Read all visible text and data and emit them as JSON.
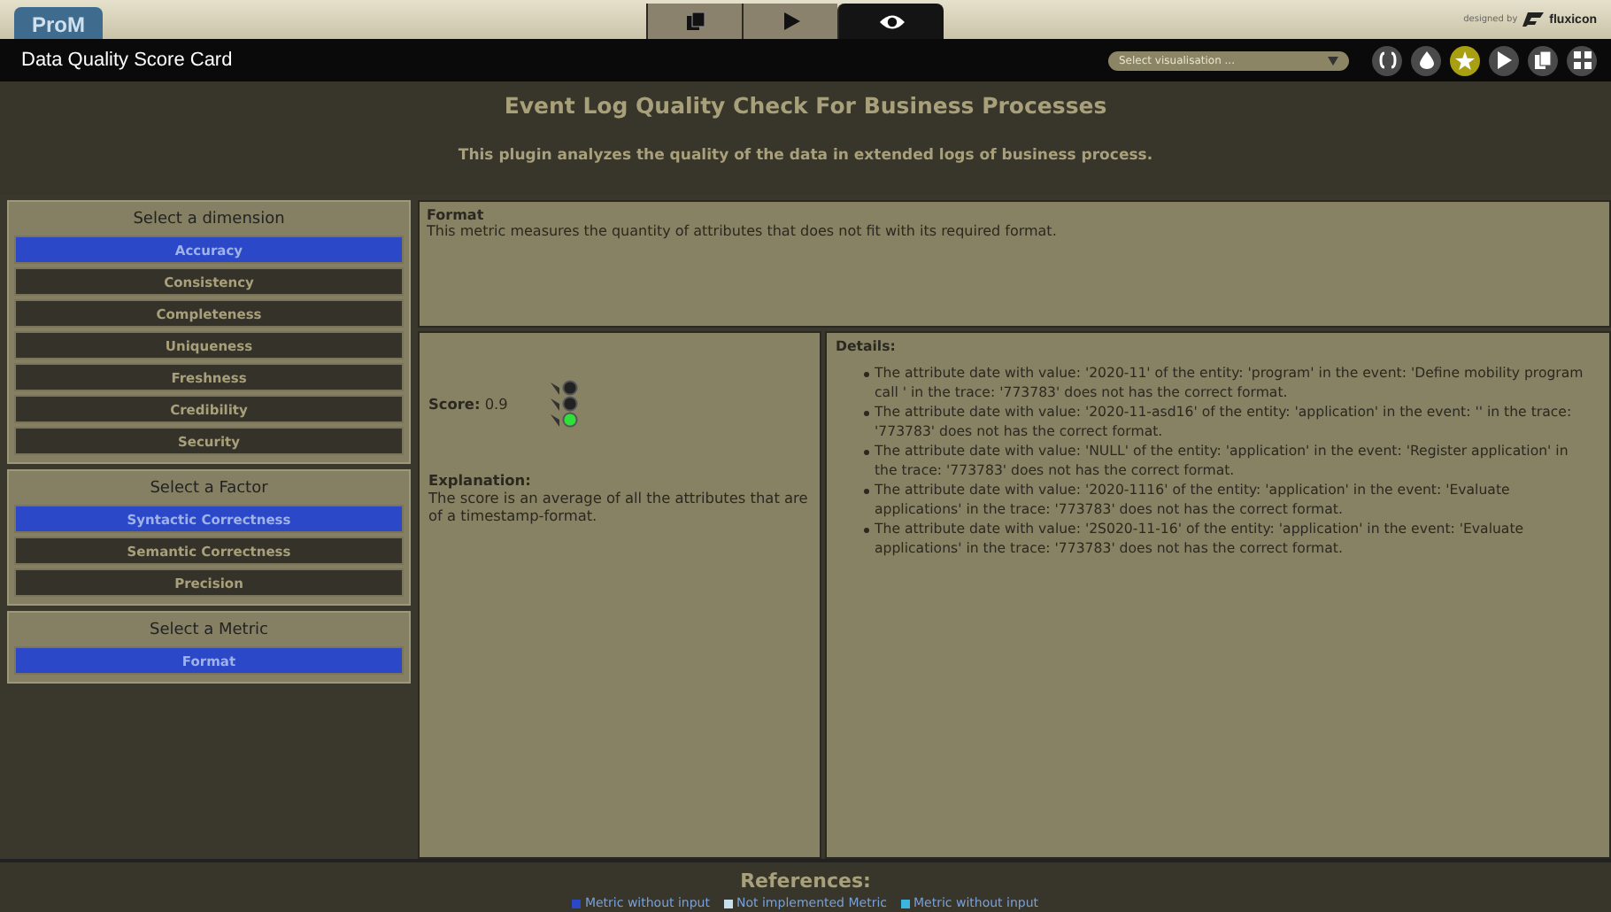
{
  "app_logo": "ProM",
  "view_tabs": [
    {
      "kind": "copy",
      "selected": false
    },
    {
      "kind": "play",
      "selected": false
    },
    {
      "kind": "eye",
      "selected": true
    }
  ],
  "brand": {
    "prefix": "designed by",
    "name": "fluxicon"
  },
  "title_bar": {
    "title": "Data Quality Score Card",
    "visualisation_select": {
      "placeholder": "Select visualisation ..."
    },
    "tools": [
      {
        "kind": "braces",
        "selected": false
      },
      {
        "kind": "drop",
        "selected": false
      },
      {
        "kind": "star",
        "selected": true
      },
      {
        "kind": "play",
        "selected": false
      },
      {
        "kind": "copy",
        "selected": false
      },
      {
        "kind": "grid",
        "selected": false
      }
    ]
  },
  "header": {
    "title": "Event Log Quality Check For Business Processes",
    "subtitle": "This plugin analyzes the quality of the data in extended logs of business process."
  },
  "sidebar": [
    {
      "title": "Select a dimension",
      "items": [
        {
          "label": "Accuracy",
          "selected": true
        },
        {
          "label": "Consistency",
          "selected": false
        },
        {
          "label": "Completeness",
          "selected": false
        },
        {
          "label": "Uniqueness",
          "selected": false
        },
        {
          "label": "Freshness",
          "selected": false
        },
        {
          "label": "Credibility",
          "selected": false
        },
        {
          "label": "Security",
          "selected": false
        }
      ]
    },
    {
      "title": "Select a Factor",
      "items": [
        {
          "label": "Syntactic Correctness",
          "selected": true
        },
        {
          "label": "Semantic Correctness",
          "selected": false
        },
        {
          "label": "Precision",
          "selected": false
        }
      ]
    },
    {
      "title": "Select a Metric",
      "items": [
        {
          "label": "Format",
          "selected": true
        }
      ]
    }
  ],
  "metric": {
    "name": "Format",
    "description": "This metric measures the quantity of attributes that does not fit with its required format."
  },
  "score": {
    "label": "Score:",
    "value": "0.9",
    "lamps": [
      {
        "on": false
      },
      {
        "on": false
      },
      {
        "on": true
      }
    ],
    "explanation_title": "Explanation:",
    "explanation": "The score is an average of all the attributes that are of a timestamp-format."
  },
  "details": {
    "title": "Details:",
    "items": [
      "The attribute date with value: '2020-11' of the entity: 'program' in the event: 'Define mobility program call ' in the trace: '773783' does not has the correct format.",
      "The attribute date with value: '2020-11-asd16' of the entity: 'application' in the event: '' in the trace: '773783' does not has the correct format.",
      "The attribute date with value: 'NULL' of the entity: 'application' in the event: 'Register application' in the trace: '773783' does not has the correct format.",
      "The attribute date with value: '2020-1116' of the entity: 'application' in the event: 'Evaluate applications' in the trace: '773783' does not has the correct format.",
      "The attribute date with value: '2S020-11-16' of the entity: 'application' in the event: 'Evaluate applications' in the trace: '773783' does not has the correct format."
    ]
  },
  "references": {
    "title": "References:",
    "legend": [
      {
        "label": "Metric without input",
        "color": "#2a48c8"
      },
      {
        "label": "Not implemented Metric",
        "color": "#c8e0ee"
      },
      {
        "label": "Metric without input",
        "color": "#3cb4e0"
      }
    ]
  }
}
